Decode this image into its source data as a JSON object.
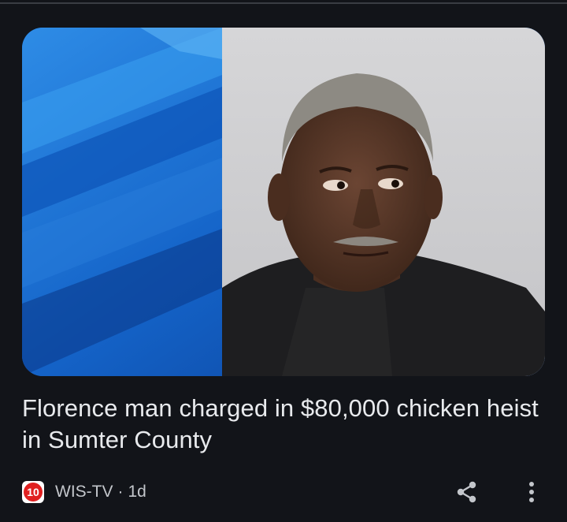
{
  "article": {
    "headline": "Florence man charged in $80,000 chicken heist in Sumter County",
    "thumbnail": {
      "icon": "mugshot-photo",
      "background_color": "#1c5fc0"
    }
  },
  "source": {
    "logo_text": "10",
    "logo_icon": "wis-tv-logo-icon",
    "logo_color": "#e02020",
    "name": "WIS-TV",
    "separator": "·",
    "age": "1d"
  },
  "actions": {
    "share_icon": "share-icon",
    "more_icon": "more-vertical-icon"
  },
  "colors": {
    "background": "#121419",
    "headline_text": "#e8eaed",
    "meta_text": "#c3c6cb"
  }
}
